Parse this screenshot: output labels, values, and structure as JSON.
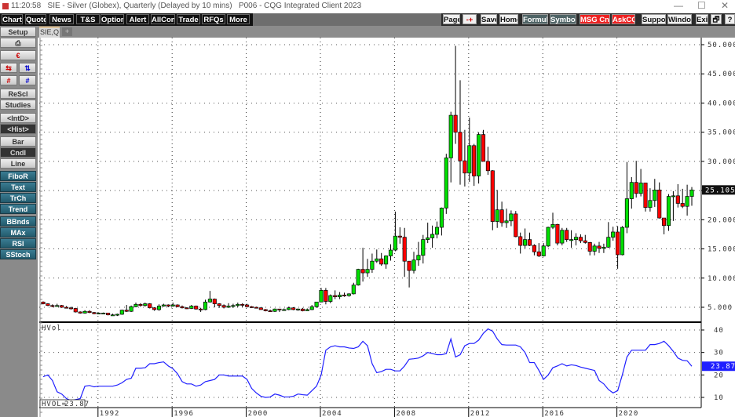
{
  "window": {
    "time": "11:20:58",
    "title": "SIE - Silver (Globex), Quarterly (Delayed by 10 mins)   P006 - CQG Integrated Client 2023",
    "controls": {
      "minimize": "—",
      "maximize": "☐",
      "close": "✕"
    }
  },
  "toolbar": {
    "left": [
      "Chart",
      "Quote",
      "News",
      "T&S",
      "Options",
      "Alert",
      "AllCon",
      "Trade",
      "RFQs",
      "More"
    ],
    "right": [
      {
        "label": "Page",
        "style": "light"
      },
      {
        "label": "-+",
        "style": "light"
      },
      {
        "label": "Save",
        "style": "light"
      },
      {
        "label": "Home",
        "style": "light"
      },
      {
        "label": "Formula",
        "style": "slate"
      },
      {
        "label": "Symbols",
        "style": "slate"
      },
      {
        "label": "MSG Cntr",
        "style": "red"
      },
      {
        "label": "AskCQG",
        "style": "red"
      },
      {
        "label": "Support",
        "style": "light"
      },
      {
        "label": "Window",
        "style": "light"
      },
      {
        "label": "Exit",
        "style": "light"
      },
      {
        "label": "🗗",
        "style": "light"
      },
      {
        "label": "?",
        "style": "light"
      }
    ]
  },
  "tabs": {
    "active": "SIE,Q",
    "add": "+"
  },
  "sidebar": {
    "setup": "Setup",
    "print_icon": "⎙",
    "euro_icon": "€",
    "arrows": [
      "⇆",
      "⇅",
      "#",
      "#"
    ],
    "buttons": [
      {
        "label": "ReScl",
        "style": "light"
      },
      {
        "label": "Studies",
        "style": "light"
      },
      {
        "label": "<IntD>",
        "style": "light"
      },
      {
        "label": "<Hist>",
        "style": "dark"
      },
      {
        "label": "Bar",
        "style": "light"
      },
      {
        "label": "Cndl",
        "style": "dark"
      },
      {
        "label": "Line",
        "style": "light"
      },
      {
        "label": "FiboR",
        "style": "teal"
      },
      {
        "label": "Text",
        "style": "teal"
      },
      {
        "label": "TrCh",
        "style": "teal"
      },
      {
        "label": "Trend",
        "style": "teal"
      },
      {
        "label": "BBnds",
        "style": "teal"
      },
      {
        "label": "MAx",
        "style": "teal"
      },
      {
        "label": "RSI",
        "style": "teal"
      },
      {
        "label": "SStoch",
        "style": "teal"
      }
    ]
  },
  "colors": {
    "up": "#00e000",
    "down": "#ff0000",
    "hvol": "#1f1fff",
    "last_price_bg": "#111111",
    "hvol_tag_bg": "#1f1fff"
  },
  "chart_data": [
    {
      "type": "candlestick",
      "title": "SIE - Silver (Globex), Quarterly",
      "start": "1989 Q1",
      "period": "quarter",
      "ylim": [
        3,
        51
      ],
      "yticks": [
        "5.000",
        "10.000",
        "15.000",
        "20.000",
        "25.000",
        "30.000",
        "35.000",
        "40.000",
        "45.000",
        "50.000"
      ],
      "ytick_values": [
        5,
        10,
        15,
        20,
        25,
        30,
        35,
        40,
        45,
        50
      ],
      "last_price": "25.105",
      "first_open": 5.9,
      "close": [
        5.6,
        5.3,
        5.2,
        5.3,
        5.0,
        4.9,
        4.8,
        4.2,
        4.0,
        4.3,
        4.1,
        3.9,
        4.0,
        4.0,
        3.7,
        3.7,
        3.8,
        4.5,
        4.3,
        5.1,
        5.5,
        5.3,
        5.6,
        4.9,
        4.6,
        5.2,
        5.4,
        5.2,
        5.4,
        5.1,
        4.9,
        4.8,
        5.2,
        4.7,
        4.6,
        5.9,
        6.4,
        5.6,
        5.3,
        5.0,
        5.2,
        5.3,
        5.5,
        5.4,
        5.1,
        5.0,
        4.9,
        4.6,
        4.4,
        4.3,
        4.7,
        4.6,
        4.6,
        4.9,
        4.6,
        4.7,
        4.4,
        4.6,
        5.1,
        5.9,
        7.9,
        6.0,
        7.0,
        6.8,
        7.1,
        7.0,
        7.3,
        8.8,
        11.5,
        10.9,
        11.5,
        12.9,
        13.3,
        12.4,
        13.8,
        14.8,
        17.2,
        17.0,
        12.9,
        11.3,
        13.1,
        13.9,
        16.6,
        16.9,
        17.5,
        18.7,
        22.0,
        30.6,
        37.9,
        35.0,
        30.1,
        28.0,
        32.7,
        27.5,
        34.6,
        30.0,
        28.4,
        19.7,
        21.7,
        19.5,
        19.8,
        21.0,
        17.1,
        15.6,
        16.6,
        15.6,
        14.5,
        13.8,
        15.5,
        18.7,
        19.2,
        16.0,
        18.2,
        16.6,
        16.6,
        17.0,
        16.4,
        16.1,
        14.6,
        15.5,
        15.1,
        15.3,
        17.0,
        17.9,
        14.0,
        18.7,
        23.6,
        26.4,
        24.5,
        26.3,
        22.1,
        23.3,
        25.1,
        20.3,
        19.0,
        24.0,
        24.1,
        22.8,
        22.3,
        24.0,
        25.105
      ],
      "high": [
        6.0,
        5.7,
        5.5,
        5.6,
        5.4,
        5.2,
        5.1,
        4.9,
        4.3,
        4.5,
        4.5,
        4.2,
        4.1,
        4.1,
        4.0,
        3.9,
        3.9,
        4.6,
        5.4,
        5.3,
        5.8,
        5.7,
        5.8,
        5.7,
        5.0,
        5.5,
        5.6,
        5.5,
        5.8,
        5.5,
        5.3,
        5.0,
        5.4,
        5.3,
        4.9,
        6.3,
        7.8,
        6.5,
        5.7,
        5.5,
        5.7,
        5.6,
        5.8,
        5.7,
        5.6,
        5.2,
        5.1,
        5.0,
        4.7,
        4.6,
        4.8,
        4.7,
        4.8,
        5.1,
        5.0,
        4.8,
        4.9,
        4.8,
        5.4,
        5.9,
        8.3,
        8.3,
        7.2,
        7.9,
        7.6,
        7.5,
        7.4,
        9.2,
        11.6,
        15.2,
        13.3,
        14.2,
        14.9,
        14.3,
        13.9,
        15.8,
        21.4,
        18.7,
        18.6,
        12.0,
        14.5,
        16.2,
        17.4,
        19.5,
        19.0,
        19.7,
        22.1,
        31.3,
        38.5,
        49.8,
        43.9,
        35.4,
        37.5,
        33.0,
        35.0,
        35.4,
        32.5,
        28.5,
        25.1,
        23.1,
        21.9,
        21.6,
        21.5,
        17.8,
        18.5,
        17.8,
        15.8,
        16.0,
        16.0,
        18.8,
        21.2,
        19.3,
        18.6,
        18.6,
        18.2,
        17.7,
        17.5,
        17.4,
        16.2,
        15.9,
        16.2,
        15.9,
        19.6,
        18.8,
        18.9,
        18.9,
        29.9,
        27.3,
        30.1,
        28.7,
        26.3,
        25.4,
        27.0,
        26.4,
        20.0,
        24.4,
        24.9,
        26.1,
        25.3,
        26.0,
        25.6
      ],
      "low": [
        5.5,
        5.2,
        5.0,
        5.1,
        4.9,
        4.8,
        4.6,
        4.1,
        3.9,
        3.9,
        4.0,
        3.8,
        3.8,
        3.9,
        3.6,
        3.6,
        3.5,
        3.7,
        4.2,
        4.2,
        5.0,
        5.1,
        5.1,
        4.8,
        4.4,
        4.4,
        5.1,
        5.0,
        5.1,
        5.0,
        4.8,
        4.7,
        4.7,
        4.6,
        4.2,
        4.5,
        5.8,
        5.0,
        4.9,
        4.8,
        4.9,
        4.9,
        5.0,
        5.0,
        5.0,
        4.9,
        4.8,
        4.6,
        4.3,
        4.2,
        4.2,
        4.2,
        4.5,
        4.5,
        4.5,
        4.4,
        4.3,
        4.4,
        4.5,
        4.9,
        5.9,
        5.5,
        5.7,
        6.4,
        6.4,
        6.8,
        6.8,
        7.2,
        8.7,
        9.4,
        10.2,
        10.9,
        12.6,
        12.1,
        11.6,
        13.0,
        14.6,
        15.9,
        10.2,
        8.4,
        10.8,
        12.1,
        12.5,
        16.0,
        15.2,
        16.8,
        17.3,
        21.0,
        26.4,
        33.0,
        26.0,
        25.7,
        26.5,
        25.8,
        26.2,
        30.0,
        27.7,
        18.2,
        18.6,
        18.8,
        18.6,
        18.9,
        17.0,
        14.2,
        15.1,
        15.5,
        13.9,
        13.6,
        13.7,
        15.3,
        18.4,
        15.6,
        15.6,
        16.2,
        15.2,
        15.6,
        16.0,
        15.9,
        13.9,
        13.9,
        14.3,
        14.3,
        15.2,
        16.4,
        11.6,
        13.9,
        17.7,
        21.9,
        23.8,
        24.0,
        21.4,
        21.4,
        22.2,
        20.2,
        17.5,
        18.1,
        19.8,
        22.1,
        22.0,
        20.7,
        22.4
      ],
      "xticks": [
        "1992",
        "1996",
        "2000",
        "2004",
        "2008",
        "2012",
        "2016",
        "2020"
      ],
      "xtick_years": [
        1992,
        1996,
        2000,
        2004,
        2008,
        2012,
        2016,
        2020
      ]
    },
    {
      "type": "line",
      "title": "HVol",
      "series_name": "HVol",
      "readout_label": "HVOL=",
      "readout_value": "23.87",
      "last_value": "23.87",
      "ylim": [
        5,
        42
      ],
      "yticks": [
        "10",
        "20",
        "30",
        "40"
      ],
      "ytick_values": [
        10,
        20,
        30,
        40
      ],
      "values": [
        19.2,
        20,
        17.5,
        12.5,
        11.5,
        9.5,
        8.5,
        9,
        9.5,
        15,
        15.3,
        14.7,
        15,
        15,
        15,
        15,
        15.5,
        16.5,
        18,
        18.5,
        23,
        23,
        23.2,
        25,
        25,
        25.5,
        25.8,
        24,
        22.8,
        20.5,
        17,
        16,
        16,
        15,
        15.5,
        17,
        17.5,
        18,
        20,
        20,
        19.5,
        19.5,
        19.5,
        19.5,
        18,
        14,
        12,
        10.5,
        10,
        10.2,
        11.5,
        11,
        10.2,
        10.2,
        10.5,
        11.5,
        11.2,
        11,
        13,
        15,
        20,
        31,
        32.5,
        33,
        32.5,
        32.5,
        32,
        31.8,
        32.5,
        35,
        33,
        25,
        21,
        21.5,
        22.5,
        22.5,
        21.8,
        21.8,
        24,
        27,
        27.2,
        27.5,
        28.5,
        30,
        29.5,
        29,
        29,
        29.5,
        36,
        28,
        29,
        33,
        34,
        34,
        35.5,
        38.5,
        40.5,
        39.5,
        36,
        33.5,
        33.3,
        33.3,
        33.3,
        32.5,
        30,
        25.5,
        25.5,
        22,
        18,
        20,
        23.2,
        24,
        25,
        24,
        24.5,
        24.2,
        23.5,
        23,
        22.5,
        22,
        17.5,
        16,
        13.5,
        12,
        13,
        20,
        28,
        31,
        31,
        31,
        31,
        33.5,
        33.5,
        34,
        35,
        33,
        30.5,
        27.5,
        26.5,
        26.3,
        23.87
      ]
    }
  ]
}
